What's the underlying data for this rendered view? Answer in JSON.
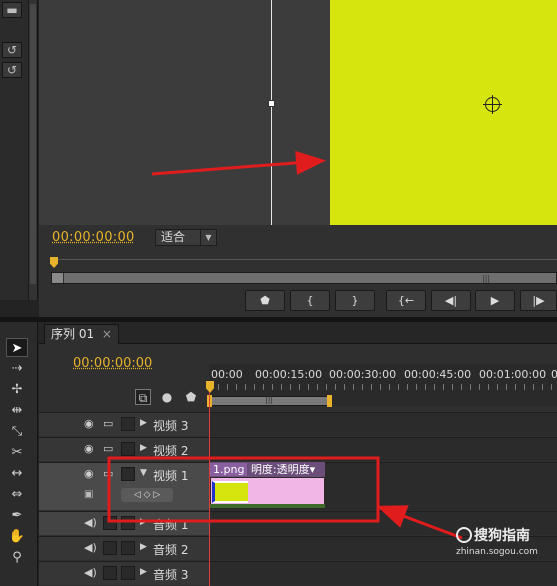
{
  "program_monitor": {
    "timecode": "00:00:00:00",
    "fit_select": "适合",
    "transport": {
      "marker": "marker-icon",
      "in": "{",
      "out": "}",
      "goto_in": "{←",
      "step_back": "◀|",
      "play": "▶",
      "step_fwd": "|▶"
    }
  },
  "sequence": {
    "tab_label": "序列 01",
    "close": "×",
    "timecode": "00:00:00:00",
    "ruler_labels": [
      "00:00",
      "00:00:15:00",
      "00:00:30:00",
      "00:00:45:00",
      "00:01:00:00",
      "0"
    ],
    "tracks": [
      {
        "name": "视频 3"
      },
      {
        "name": "视频 2"
      },
      {
        "name": "视频 1"
      },
      {
        "name": "音频 1"
      },
      {
        "name": "音频 2"
      },
      {
        "name": "音频 3"
      }
    ],
    "clip": {
      "name": "1.png",
      "effect": "明度:透明度▾"
    }
  },
  "watermark": {
    "brand": "搜狗指南",
    "url": "zhinan.sogou.com"
  },
  "colors": {
    "timecode": "#e8b32a",
    "frame_yellow": "#d6e50e",
    "annotation_red": "#e01c1c",
    "clip_pink": "#f1b6e6"
  }
}
